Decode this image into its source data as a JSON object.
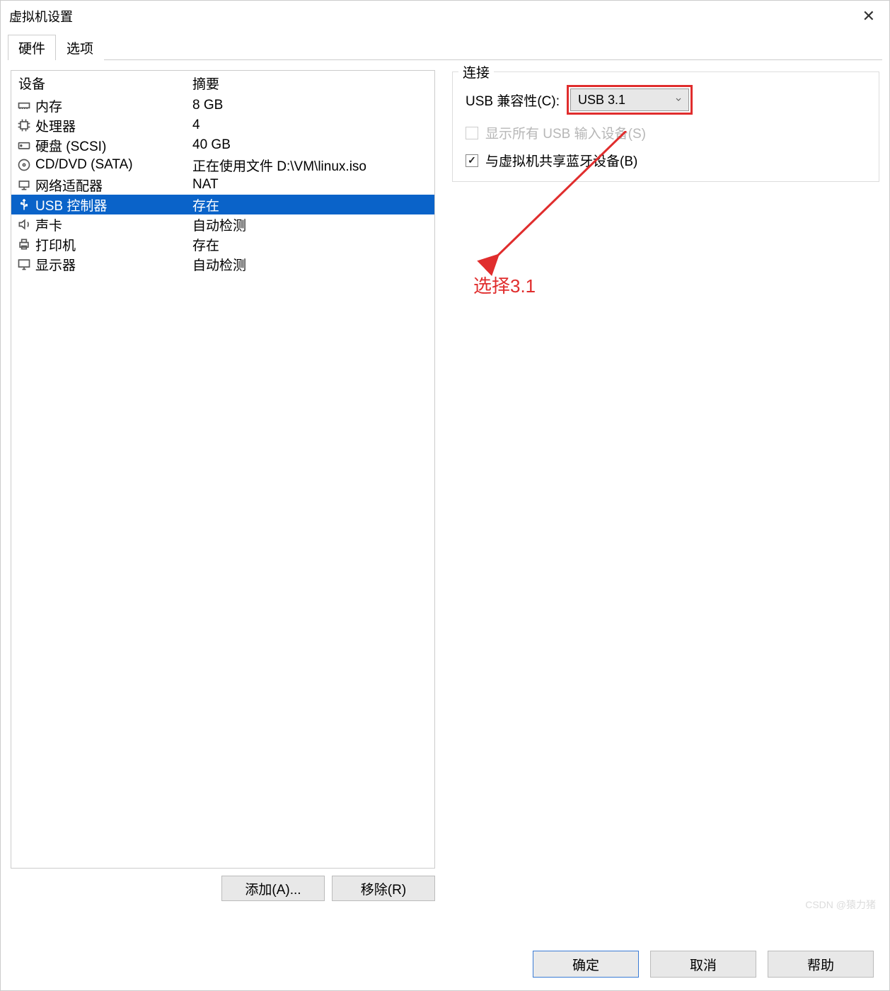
{
  "window": {
    "title": "虚拟机设置"
  },
  "tabs": {
    "hardware": "硬件",
    "options": "选项"
  },
  "device_header": {
    "device": "设备",
    "summary": "摘要"
  },
  "devices": [
    {
      "name": "内存",
      "summary": "8 GB",
      "icon": "memory"
    },
    {
      "name": "处理器",
      "summary": "4",
      "icon": "cpu"
    },
    {
      "name": "硬盘 (SCSI)",
      "summary": "40 GB",
      "icon": "hdd"
    },
    {
      "name": "CD/DVD (SATA)",
      "summary": "正在使用文件 D:\\VM\\linux.iso",
      "icon": "cd"
    },
    {
      "name": "网络适配器",
      "summary": "NAT",
      "icon": "network"
    },
    {
      "name": "USB 控制器",
      "summary": "存在",
      "icon": "usb",
      "selected": true
    },
    {
      "name": "声卡",
      "summary": "自动检测",
      "icon": "sound"
    },
    {
      "name": "打印机",
      "summary": "存在",
      "icon": "printer"
    },
    {
      "name": "显示器",
      "summary": "自动检测",
      "icon": "display"
    }
  ],
  "left_buttons": {
    "add": "添加(A)...",
    "remove": "移除(R)"
  },
  "connection": {
    "legend": "连接",
    "usb_compat_label": "USB 兼容性(C):",
    "usb_compat_value": "USB 3.1",
    "show_all_label": "显示所有 USB 输入设备(S)",
    "show_all_checked": false,
    "show_all_disabled": true,
    "share_bt_label": "与虚拟机共享蓝牙设备(B)",
    "share_bt_checked": true
  },
  "annotation": {
    "text": "选择3.1"
  },
  "footer": {
    "ok": "确定",
    "cancel": "取消",
    "help": "帮助"
  },
  "watermark": "CSDN @猿力猪"
}
